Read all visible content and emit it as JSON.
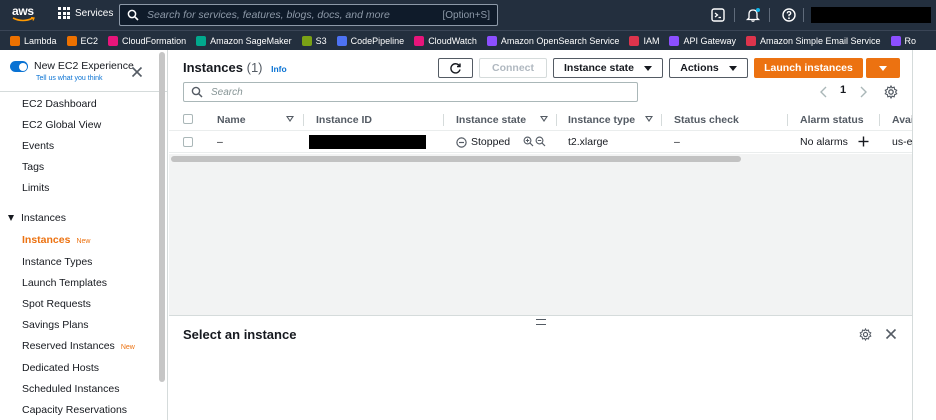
{
  "topnav": {
    "logo_text": "aws",
    "services_label": "Services",
    "search_placeholder": "Search for services, features, blogs, docs, and more",
    "search_shortcut": "[Option+S]",
    "icons": [
      "cloudshell-icon",
      "bell-icon",
      "help-icon"
    ]
  },
  "favorites": [
    {
      "label": "Lambda",
      "color": "#ed7100"
    },
    {
      "label": "EC2",
      "color": "#ed7100"
    },
    {
      "label": "CloudFormation",
      "color": "#e7157b"
    },
    {
      "label": "Amazon SageMaker",
      "color": "#01a88d"
    },
    {
      "label": "S3",
      "color": "#7aa116"
    },
    {
      "label": "CodePipeline",
      "color": "#4d72f3"
    },
    {
      "label": "CloudWatch",
      "color": "#e7157b"
    },
    {
      "label": "Amazon OpenSearch Service",
      "color": "#8c4fff"
    },
    {
      "label": "IAM",
      "color": "#dd344c"
    },
    {
      "label": "API Gateway",
      "color": "#8c4fff"
    },
    {
      "label": "Amazon Simple Email Service",
      "color": "#dd344c"
    },
    {
      "label": "Ro",
      "color": "#8c4fff"
    }
  ],
  "sidebar": {
    "new_experience_title": "New EC2 Experience",
    "new_experience_sub": "Tell us what you think",
    "items": [
      {
        "label": "EC2 Dashboard"
      },
      {
        "label": "EC2 Global View"
      },
      {
        "label": "Events"
      },
      {
        "label": "Tags"
      },
      {
        "label": "Limits"
      }
    ],
    "section_instances": "Instances",
    "instances_items": [
      {
        "label": "Instances",
        "badge": "New"
      },
      {
        "label": "Instance Types"
      },
      {
        "label": "Launch Templates"
      },
      {
        "label": "Spot Requests"
      },
      {
        "label": "Savings Plans"
      },
      {
        "label": "Reserved Instances",
        "badge": "New"
      },
      {
        "label": "Dedicated Hosts"
      },
      {
        "label": "Scheduled Instances"
      },
      {
        "label": "Capacity Reservations"
      }
    ]
  },
  "main": {
    "title": "Instances",
    "count": "(1)",
    "info": "Info",
    "buttons": {
      "connect": "Connect",
      "instance_state": "Instance state",
      "actions": "Actions",
      "launch": "Launch instances"
    },
    "search_placeholder": "Search",
    "page_number": "1",
    "columns": [
      "Name",
      "Instance ID",
      "Instance state",
      "Instance type",
      "Status check",
      "Alarm status",
      "Avail"
    ],
    "row": {
      "name": "–",
      "instance_state": "Stopped",
      "instance_type": "t2.xlarge",
      "status_check": "–",
      "alarm_status": "No alarms",
      "availability_zone": "us-ea"
    },
    "detail_title": "Select an instance"
  }
}
